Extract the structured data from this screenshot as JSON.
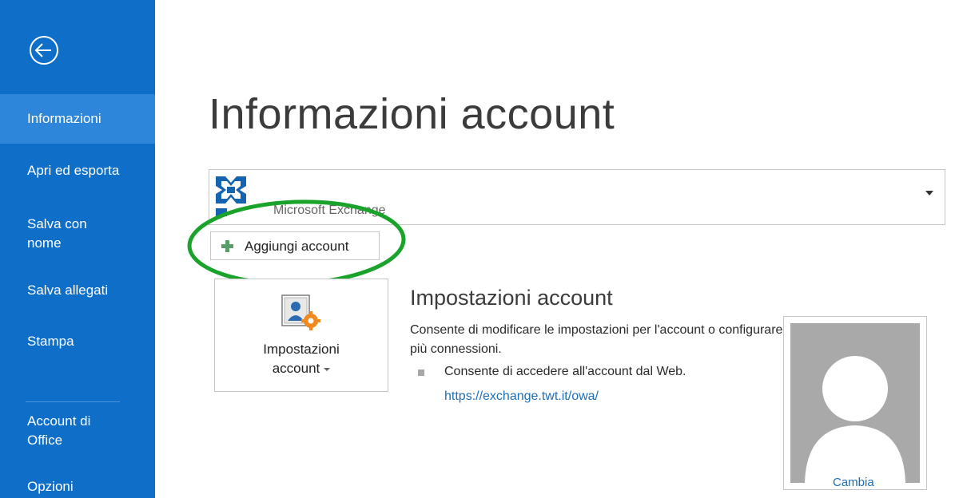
{
  "sidebar": {
    "back_icon": "back-arrow-icon",
    "items": [
      {
        "label": "Informazioni",
        "active": true
      },
      {
        "label": "Apri ed esporta",
        "active": false
      },
      {
        "label": "Salva con nome",
        "active": false
      },
      {
        "label": "Salva allegati",
        "active": false
      },
      {
        "label": "Stampa",
        "active": false
      },
      {
        "label": "Account di Office",
        "active": false
      },
      {
        "label": "Opzioni",
        "active": false
      }
    ],
    "background_color": "#0f6ec8",
    "active_color": "#2e86da"
  },
  "main": {
    "title": "Informazioni account",
    "account_selector": {
      "account_type": "Microsoft Exchange",
      "icon": "exchange-logo-icon"
    },
    "add_account_button": {
      "label": "Aggiungi account",
      "icon": "plus-icon"
    },
    "settings_tile": {
      "line1": "Impostazioni",
      "line2": "account",
      "icon": "account-settings-icon"
    },
    "settings_section": {
      "heading": "Impostazioni account",
      "description": "Consente di modificare le impostazioni per l'account o configurare più connessioni.",
      "bullet": "Consente di accedere all'account dal Web.",
      "link": "https://exchange.twt.it/owa/"
    },
    "profile": {
      "change_label": "Cambia",
      "icon": "person-placeholder-icon"
    },
    "accent_color": "#1e6fb6",
    "highlight_color": "#1aa32b"
  }
}
